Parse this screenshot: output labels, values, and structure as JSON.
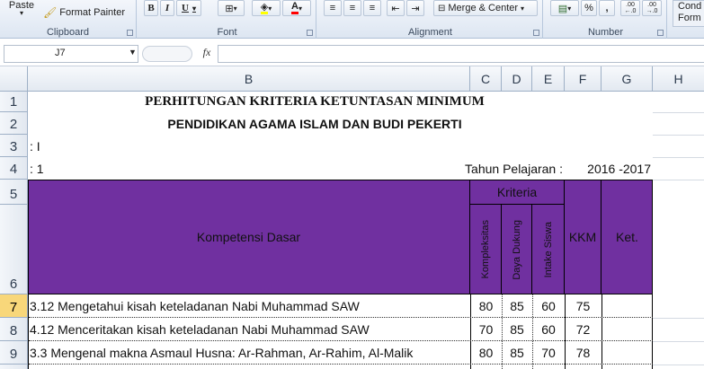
{
  "ribbon": {
    "clipboard": {
      "paste_label": "Paste",
      "format_painter_label": "Format Painter",
      "group_label": "Clipboard"
    },
    "font": {
      "bold": "B",
      "italic": "I",
      "underline": "U",
      "font_color_letter": "A",
      "group_label": "Font"
    },
    "alignment": {
      "merge_label": "Merge & Center",
      "group_label": "Alignment"
    },
    "number": {
      "percent": "%",
      "comma": ",",
      "inc_decimal": ".00 ←.0",
      "dec_decimal": ".00 →.0",
      "group_label": "Number"
    },
    "styles": {
      "cond_label_1": "Cond",
      "cond_label_2": "Form"
    }
  },
  "formula_bar": {
    "cell_ref": "J7",
    "fx_label": "fx",
    "value": ""
  },
  "columns": [
    "B",
    "C",
    "D",
    "E",
    "F",
    "G",
    "H"
  ],
  "rows": [
    "1",
    "2",
    "3",
    "4",
    "5",
    "6",
    "7",
    "8",
    "9"
  ],
  "selected_row": "7",
  "sheet": {
    "title1": "PERHITUNGAN KRITERIA KETUNTASAN MINIMUM",
    "title2": "PENDIDIKAN AGAMA ISLAM DAN BUDI PEKERTI",
    "row3_text": ": I",
    "row4_text": ": 1",
    "tahun_label": "Tahun Pelajaran :",
    "tahun_value": "2016 -2017",
    "header": {
      "kompetensi": "Kompetensi Dasar",
      "kriteria": "Kriteria",
      "kompleksitas": "Kompleksitas",
      "daya_dukung": "Daya Dukung",
      "intake": "Intake Siswa",
      "kkm": "KKM",
      "ket": "Ket."
    },
    "data_rows": [
      {
        "kd": "3.12  Mengetahui kisah keteladanan Nabi Muhammad SAW",
        "c": "80",
        "d": "85",
        "e": "60",
        "f": "75",
        "g": ""
      },
      {
        "kd": "4.12  Menceritakan kisah keteladanan Nabi Muhammad SAW",
        "c": "70",
        "d": "85",
        "e": "60",
        "f": "72",
        "g": ""
      },
      {
        "kd": "3.3  Mengenal makna Asmaul Husna: Ar-Rahman, Ar-Rahim, Al-Malik",
        "c": "80",
        "d": "85",
        "e": "70",
        "f": "78",
        "g": ""
      }
    ]
  },
  "colors": {
    "header_fill": "#7030a0",
    "selected_row_header": "#f8d77a"
  }
}
